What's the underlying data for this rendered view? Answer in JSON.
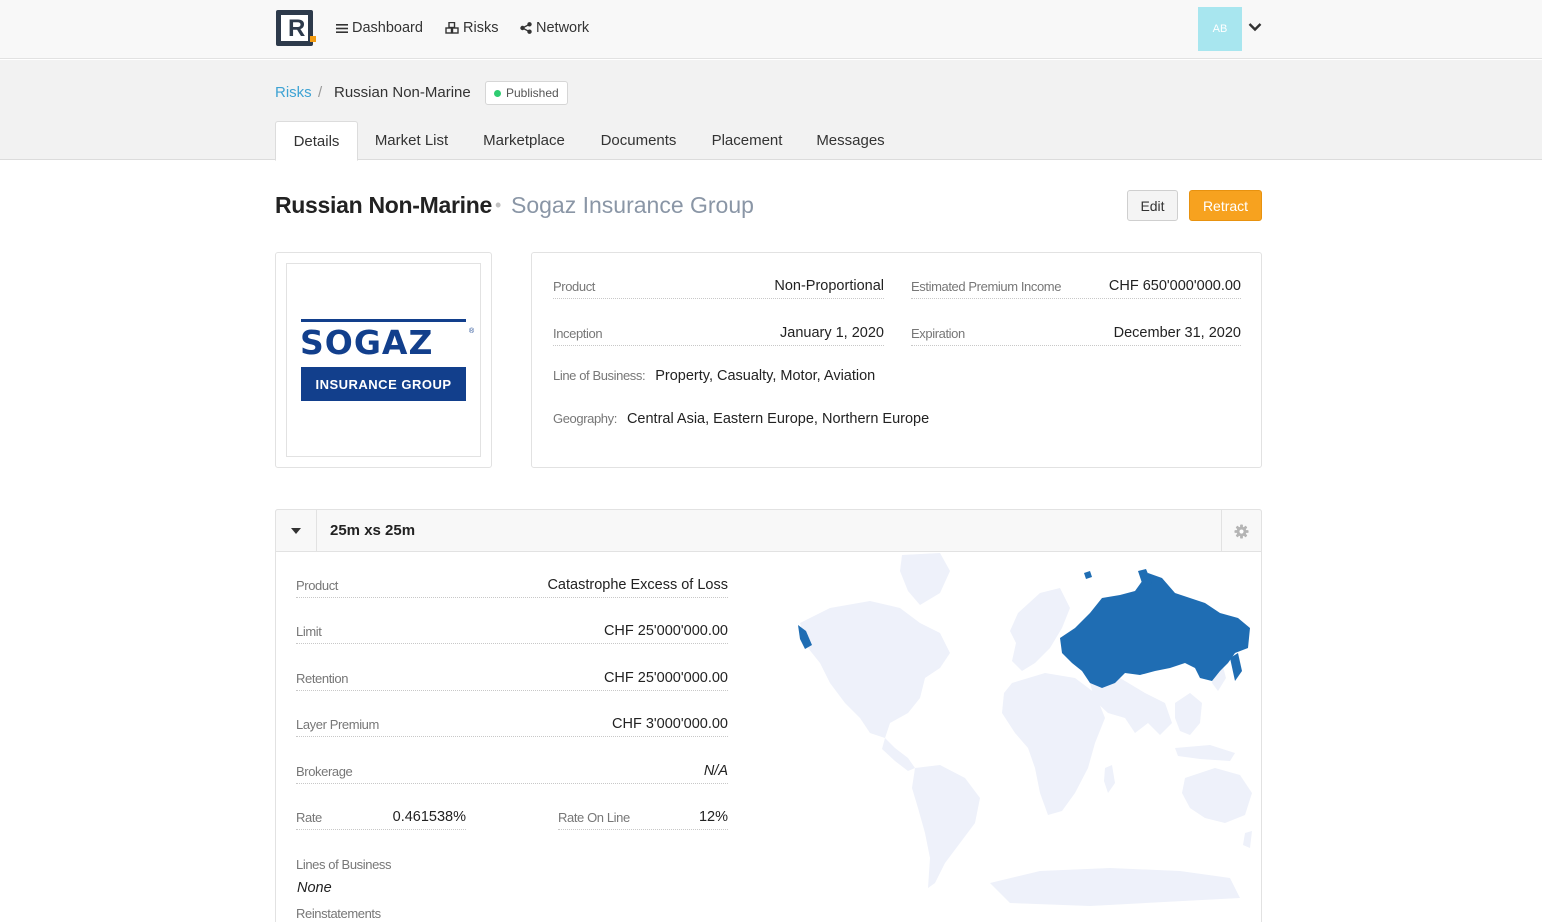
{
  "nav": {
    "dashboard": "Dashboard",
    "risks": "Risks",
    "network": "Network",
    "avatar_initials": "AB"
  },
  "breadcrumb": {
    "parent": "Risks",
    "separator": "/",
    "current": "Russian Non-Marine",
    "status": "Published"
  },
  "tabs": [
    {
      "label": "Details",
      "active": true
    },
    {
      "label": "Market List"
    },
    {
      "label": "Marketplace"
    },
    {
      "label": "Documents"
    },
    {
      "label": "Placement"
    },
    {
      "label": "Messages"
    }
  ],
  "header": {
    "title": "Russian Non-Marine",
    "subtitle": "Sogaz Insurance Group",
    "edit_label": "Edit",
    "retract_label": "Retract"
  },
  "cedent_logo": {
    "word": "SOGAZ",
    "tagline": "INSURANCE GROUP",
    "mark": "®"
  },
  "details": {
    "product_label": "Product",
    "product": "Non-Proportional",
    "epi_label": "Estimated Premium Income",
    "epi": "CHF 650'000'000.00",
    "inception_label": "Inception",
    "inception": "January 1, 2020",
    "expiration_label": "Expiration",
    "expiration": "December 31, 2020",
    "lob_label": "Line of Business:",
    "lob": "Property, Casualty, Motor, Aviation",
    "geo_label": "Geography:",
    "geo": "Central Asia, Eastern Europe, Northern Europe"
  },
  "layer": {
    "title": "25m xs 25m",
    "product_label": "Product",
    "product": "Catastrophe Excess of Loss",
    "limit_label": "Limit",
    "limit": "CHF 25'000'000.00",
    "retention_label": "Retention",
    "retention": "CHF 25'000'000.00",
    "premium_label": "Layer Premium",
    "premium": "CHF 3'000'000.00",
    "brokerage_label": "Brokerage",
    "brokerage": "N/A",
    "rate_label": "Rate",
    "rate": "0.461538%",
    "rol_label": "Rate On Line",
    "rol": "12%",
    "lines_label": "Lines of Business",
    "lines": "None",
    "reinstatements_label": "Reinstatements"
  },
  "colors": {
    "accent_link": "#3ea3d4",
    "retract": "#f7a21f",
    "map_land": "#eef1fa",
    "map_highlight": "#1f6db3",
    "sogaz_blue": "#123f8c"
  }
}
